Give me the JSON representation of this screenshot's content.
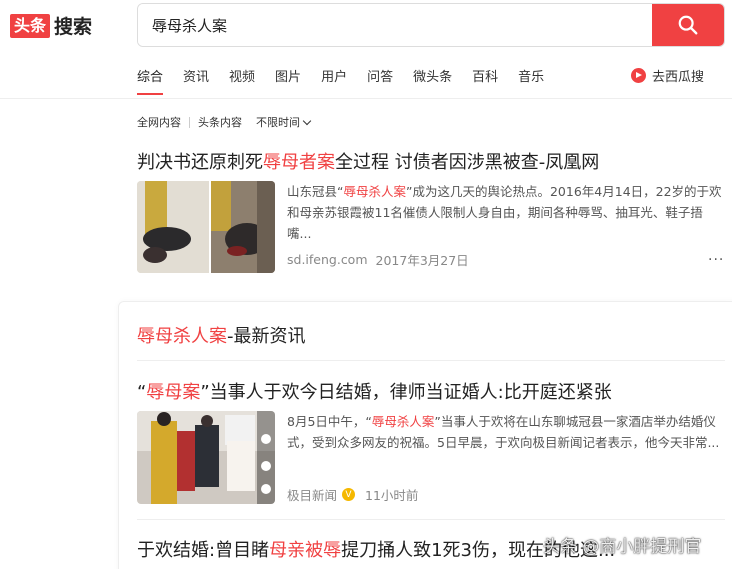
{
  "header": {
    "logo_box": "头条",
    "logo_text": "搜索",
    "search_value": "辱母杀人案"
  },
  "tabs": [
    {
      "label": "综合",
      "active": true
    },
    {
      "label": "资讯"
    },
    {
      "label": "视频"
    },
    {
      "label": "图片"
    },
    {
      "label": "用户"
    },
    {
      "label": "问答"
    },
    {
      "label": "微头条"
    },
    {
      "label": "百科"
    },
    {
      "label": "音乐"
    }
  ],
  "xigua_label": "去西瓜搜",
  "filters": {
    "all": "全网内容",
    "toutiao": "头条内容",
    "time": "不限时间"
  },
  "result1": {
    "title_pre": "判决书还原刺死",
    "title_hl": "辱母者案",
    "title_post": "全过程 讨债者因涉黑被查-凤凰网",
    "snippet_pre": "山东冠县“",
    "snippet_hl": "辱母杀人案",
    "snippet_post": "”成为这几天的舆论热点。2016年4月14日，22岁的于欢和母亲苏银霞被11名催债人限制人身自由，期间各种辱骂、抽耳光、鞋子捂嘴...",
    "source": "sd.ifeng.com",
    "date": "2017年3月27日",
    "more": "···"
  },
  "card": {
    "title_hl": "辱母杀人案",
    "title_post": "-最新资讯"
  },
  "result2": {
    "title_pre": "“",
    "title_hl": "辱母案",
    "title_post": "”当事人于欢今日结婚，律师当证婚人:比开庭还紧张",
    "snippet_pre": "8月5日中午，“",
    "snippet_hl": "辱母杀人案",
    "snippet_post": "”当事人于欢将在山东聊城冠县一家酒店举办结婚仪式，受到众多网友的祝福。5日早晨，于欢向极目新闻记者表示，他今天非常...",
    "source": "极目新闻",
    "verified": "V",
    "date": "11小时前"
  },
  "result3": {
    "title_pre": "于欢结婚:曾目睹",
    "title_hl": "母亲被辱",
    "title_post": "提刀捅人致1死3伤，现在的他这..."
  },
  "watermark": "头条 @商小胖提刑官",
  "colors": {
    "accent": "#f04142"
  },
  "icons": {
    "search": "search-icon",
    "xigua": "xigua-play-icon",
    "more": "more-dots-icon"
  }
}
